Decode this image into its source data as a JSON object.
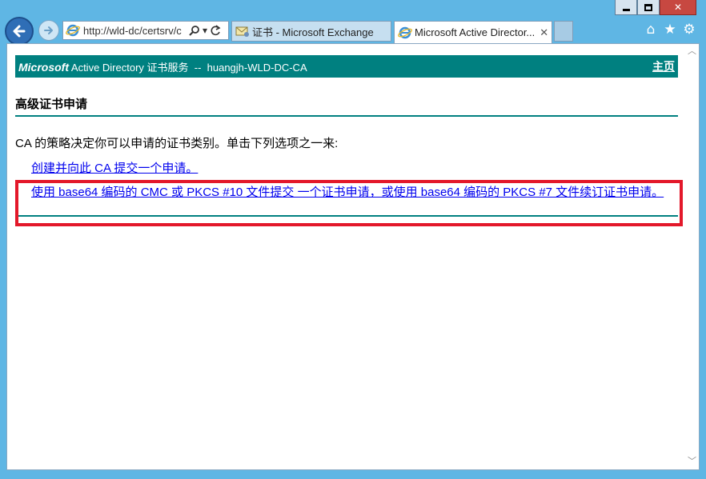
{
  "window": {
    "caption": {
      "minimize": "",
      "maximize": "",
      "close": "✕"
    }
  },
  "toolbar": {
    "address": "http://wld-dc/certsrv/c",
    "tabs": [
      {
        "label": "证书 - Microsoft Exchange",
        "active": false
      },
      {
        "label": "Microsoft Active Director...",
        "active": true,
        "close": "✕"
      }
    ]
  },
  "page": {
    "header": {
      "brand": "Microsoft",
      "title": " Active Directory 证书服务  --  huangjh-WLD-DC-CA",
      "home": "主页"
    },
    "section_title": "高级证书申请",
    "intro": "CA 的策略决定你可以申请的证书类别。单击下列选项之一来:",
    "links": [
      {
        "label": "创建并向此 CA 提交一个申请。"
      },
      {
        "label": "使用 base64 编码的 CMC 或 PKCS #10 文件提交 一个证书申请，或使用 base64 编码的 PKCS #7 文件续订证书申请。",
        "highlighted": true
      }
    ]
  },
  "colors": {
    "header_bg": "#008080",
    "link": "#0000ee",
    "highlight": "#e3182a",
    "chrome_bg": "#5fb6e4"
  }
}
